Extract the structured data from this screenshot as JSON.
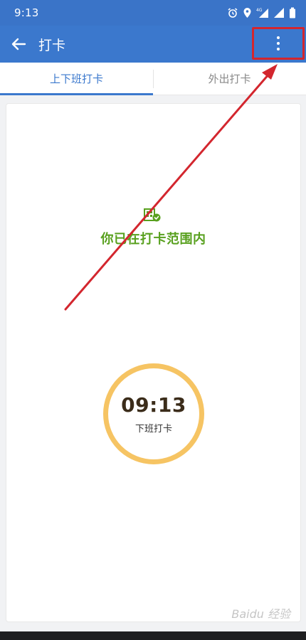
{
  "status_bar": {
    "time": "9:13",
    "icons": [
      "alarm-icon",
      "location-icon",
      "4g-signal-icon",
      "cell-signal-icon",
      "battery-icon"
    ],
    "network_label": "4G"
  },
  "app_bar": {
    "back_icon": "arrow-left-icon",
    "title": "打卡",
    "more_icon": "more-vert-icon"
  },
  "tabs": [
    {
      "label": "上下班打卡",
      "active": true
    },
    {
      "label": "外出打卡",
      "active": false
    }
  ],
  "punch_card": {
    "range_status": "你已在打卡范围内",
    "range_icon": "building-check-icon",
    "clock_time": "09:13",
    "clock_label": "下班打卡"
  },
  "watermark": "Baidu 经验",
  "colors": {
    "primary": "#3b78cd",
    "status_bar": "#3a74c8",
    "success_green": "#58a01e",
    "ring_yellow": "#f6c463",
    "annotation_red": "#d3262e"
  }
}
